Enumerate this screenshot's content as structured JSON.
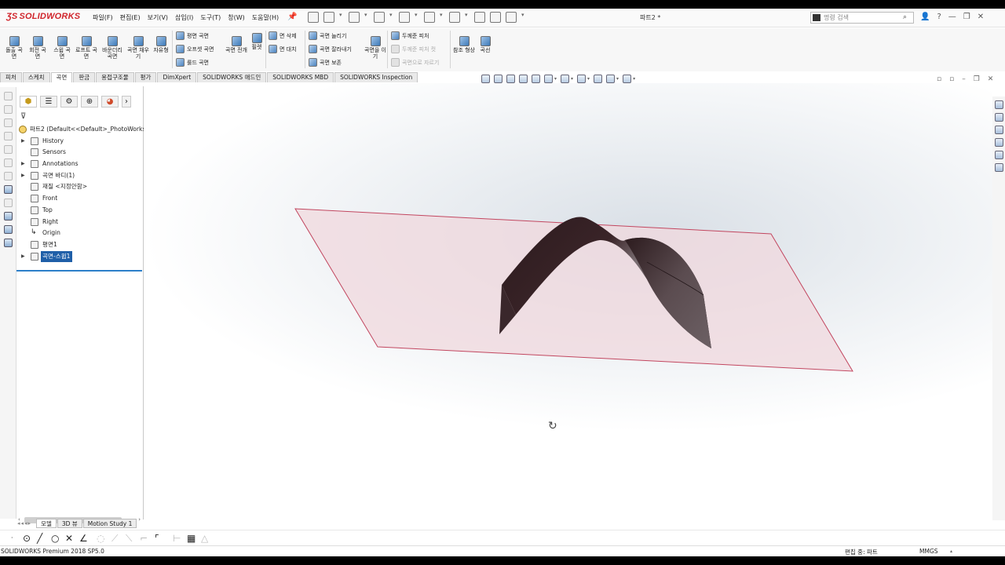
{
  "app": {
    "logo_text": "SOLIDWORKS",
    "document_title": "파트2 *",
    "search_placeholder": "명령 검색"
  },
  "menu": [
    "파일(F)",
    "편집(E)",
    "보기(V)",
    "삽입(I)",
    "도구(T)",
    "창(W)",
    "도움말(H)"
  ],
  "ribbon": {
    "large": [
      {
        "label": "돌출 곡면",
        "name": "extruded-surface-button"
      },
      {
        "label": "회전 곡면",
        "name": "revolved-surface-button"
      },
      {
        "label": "스윕 곡면",
        "name": "swept-surface-button"
      },
      {
        "label": "로프트 곡면",
        "name": "lofted-surface-button"
      },
      {
        "label": "바운더리 곡면",
        "name": "boundary-surface-button"
      },
      {
        "label": "곡면 채우기",
        "name": "filled-surface-button"
      },
      {
        "label": "자유형",
        "name": "freeform-button"
      },
      {
        "label": "곡면 전개",
        "name": "surface-flatten-button"
      },
      {
        "label": "필렛",
        "name": "fillet-button"
      },
      {
        "label": "곡면을 이기",
        "name": "knit-surface-button"
      },
      {
        "label": "참조 형상",
        "name": "reference-geometry-button"
      },
      {
        "label": "곡선",
        "name": "curves-button"
      }
    ],
    "small": [
      {
        "label": "평면 곡면",
        "name": "planar-surface-button",
        "disabled": false
      },
      {
        "label": "오프셋 곡면",
        "name": "offset-surface-button",
        "disabled": false
      },
      {
        "label": "룰드 곡면",
        "name": "ruled-surface-button",
        "disabled": false
      },
      {
        "label": "면 삭제",
        "name": "delete-face-button",
        "disabled": false
      },
      {
        "label": "면 대치",
        "name": "replace-face-button",
        "disabled": false
      },
      {
        "label": "곡면 늘리기",
        "name": "extend-surface-button",
        "disabled": false
      },
      {
        "label": "곡면 잘라내기",
        "name": "trim-surface-button",
        "disabled": false
      },
      {
        "label": "곡면 보존",
        "name": "untrim-surface-button",
        "disabled": false
      },
      {
        "label": "두께준 피처",
        "name": "thicken-button",
        "disabled": false
      },
      {
        "label": "두께준 피처 컷",
        "name": "thickened-cut-button",
        "disabled": true
      },
      {
        "label": "곡면으로 자르기",
        "name": "cut-with-surface-button",
        "disabled": true
      }
    ]
  },
  "tabs": [
    "피처",
    "스케치",
    "곡면",
    "판금",
    "용접구조물",
    "평가",
    "DimXpert",
    "SOLIDWORKS 애드인",
    "SOLIDWORKS MBD",
    "SOLIDWORKS Inspection"
  ],
  "active_tab": "곡면",
  "feature_tree": {
    "root": "파트2  (Default<<Default>_PhotoWorks",
    "items": [
      {
        "label": "History",
        "expand": true
      },
      {
        "label": "Sensors",
        "expand": false
      },
      {
        "label": "Annotations",
        "expand": true
      },
      {
        "label": "곡면 바디(1)",
        "expand": true
      },
      {
        "label": "재질 <지정안함>",
        "expand": false
      },
      {
        "label": "Front",
        "expand": false
      },
      {
        "label": "Top",
        "expand": false
      },
      {
        "label": "Right",
        "expand": false
      },
      {
        "label": "Origin",
        "expand": false
      },
      {
        "label": "평면1",
        "expand": false
      },
      {
        "label": "곡면-스윕1",
        "expand": true,
        "selected": true
      }
    ]
  },
  "model_tabs": [
    "모델",
    "3D 뷰",
    "Motion Study 1"
  ],
  "active_model_tab": "모델",
  "status": {
    "product": "SOLIDWORKS Premium 2018 SP5.0",
    "editing": "편집 중: 파트",
    "units": "MMGS"
  },
  "colors": {
    "brand_red": "#d0242b",
    "selection_blue": "#1f5fa8",
    "plane_edge": "#c2465f",
    "plane_fill": "#f2dde2",
    "surface_dark": "#2a1a1c"
  }
}
